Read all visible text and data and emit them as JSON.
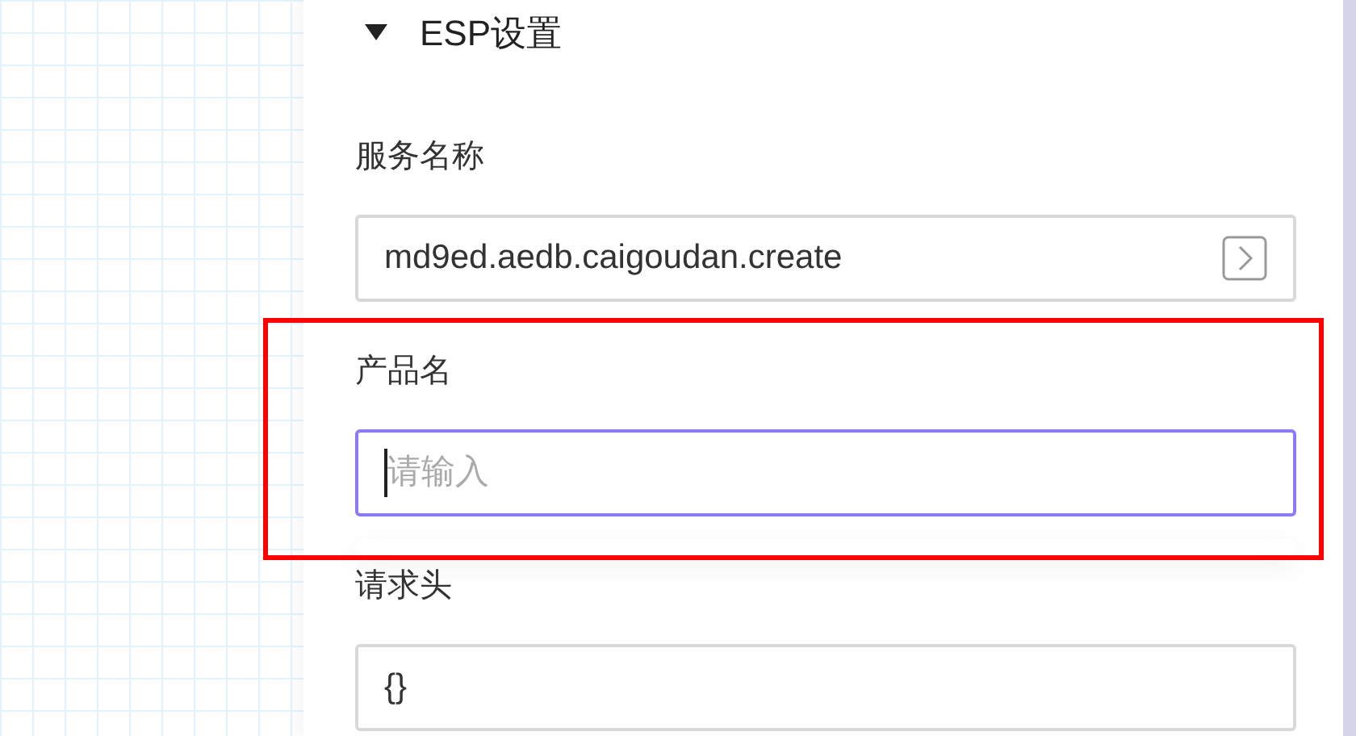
{
  "section": {
    "title": "ESP设置",
    "expanded": true
  },
  "fields": [
    {
      "kind": "picker",
      "label": "服务名称",
      "value": "md9ed.aedb.caigoudan.create",
      "focused": false
    },
    {
      "kind": "text",
      "label": "产品名",
      "placeholder": "请输入",
      "focused": true,
      "popup_open": true
    },
    {
      "kind": "text",
      "label": "请求头",
      "value": "{}",
      "focused": false
    }
  ],
  "highlight": {
    "shown": true
  }
}
